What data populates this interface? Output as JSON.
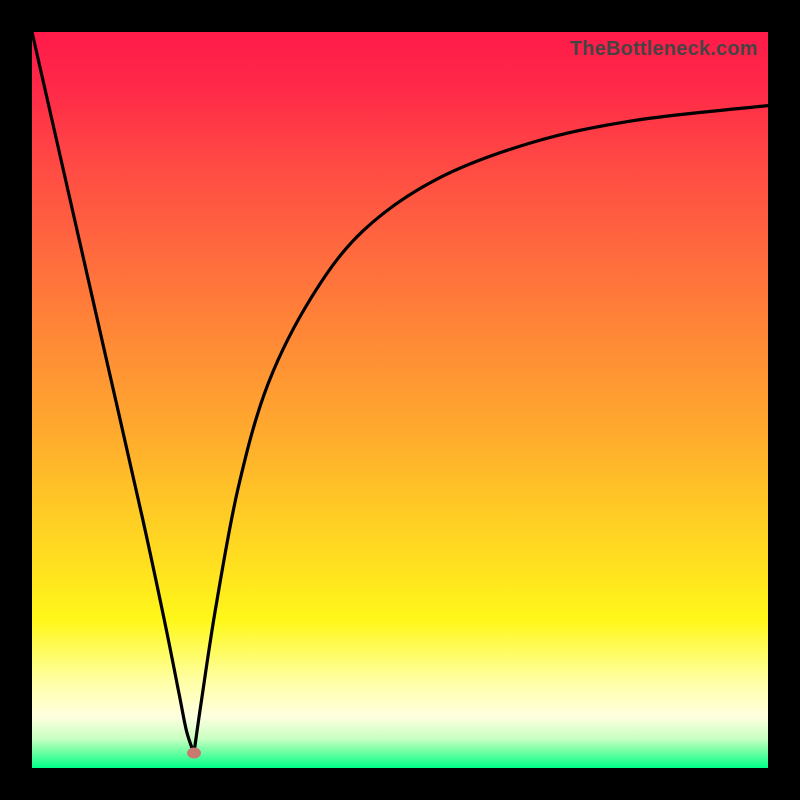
{
  "watermark": "TheBottleneck.com",
  "colors": {
    "frame": "#000000",
    "curve": "#000000",
    "marker": "#c97a70",
    "gradient_stops": [
      "#ff1a4a",
      "#ff4a44",
      "#ff8a36",
      "#ffc726",
      "#fff81a",
      "#ffffe0",
      "#7effa8",
      "#00ff88"
    ]
  },
  "chart_data": {
    "type": "line",
    "title": "",
    "xlabel": "",
    "ylabel": "",
    "xlim": [
      0,
      100
    ],
    "ylim": [
      0,
      100
    ],
    "grid": false,
    "legend": false,
    "marker": {
      "x": 22,
      "y": 2
    },
    "series": [
      {
        "name": "left-branch",
        "x": [
          0,
          5,
          10,
          15,
          18,
          20,
          21,
          22
        ],
        "values": [
          100,
          78,
          56,
          34,
          20,
          10,
          5,
          2
        ]
      },
      {
        "name": "right-branch",
        "x": [
          22,
          23,
          25,
          28,
          32,
          38,
          45,
          55,
          68,
          82,
          100
        ],
        "values": [
          2,
          9,
          22,
          38,
          52,
          64,
          73,
          80,
          85,
          88,
          90
        ]
      }
    ]
  }
}
